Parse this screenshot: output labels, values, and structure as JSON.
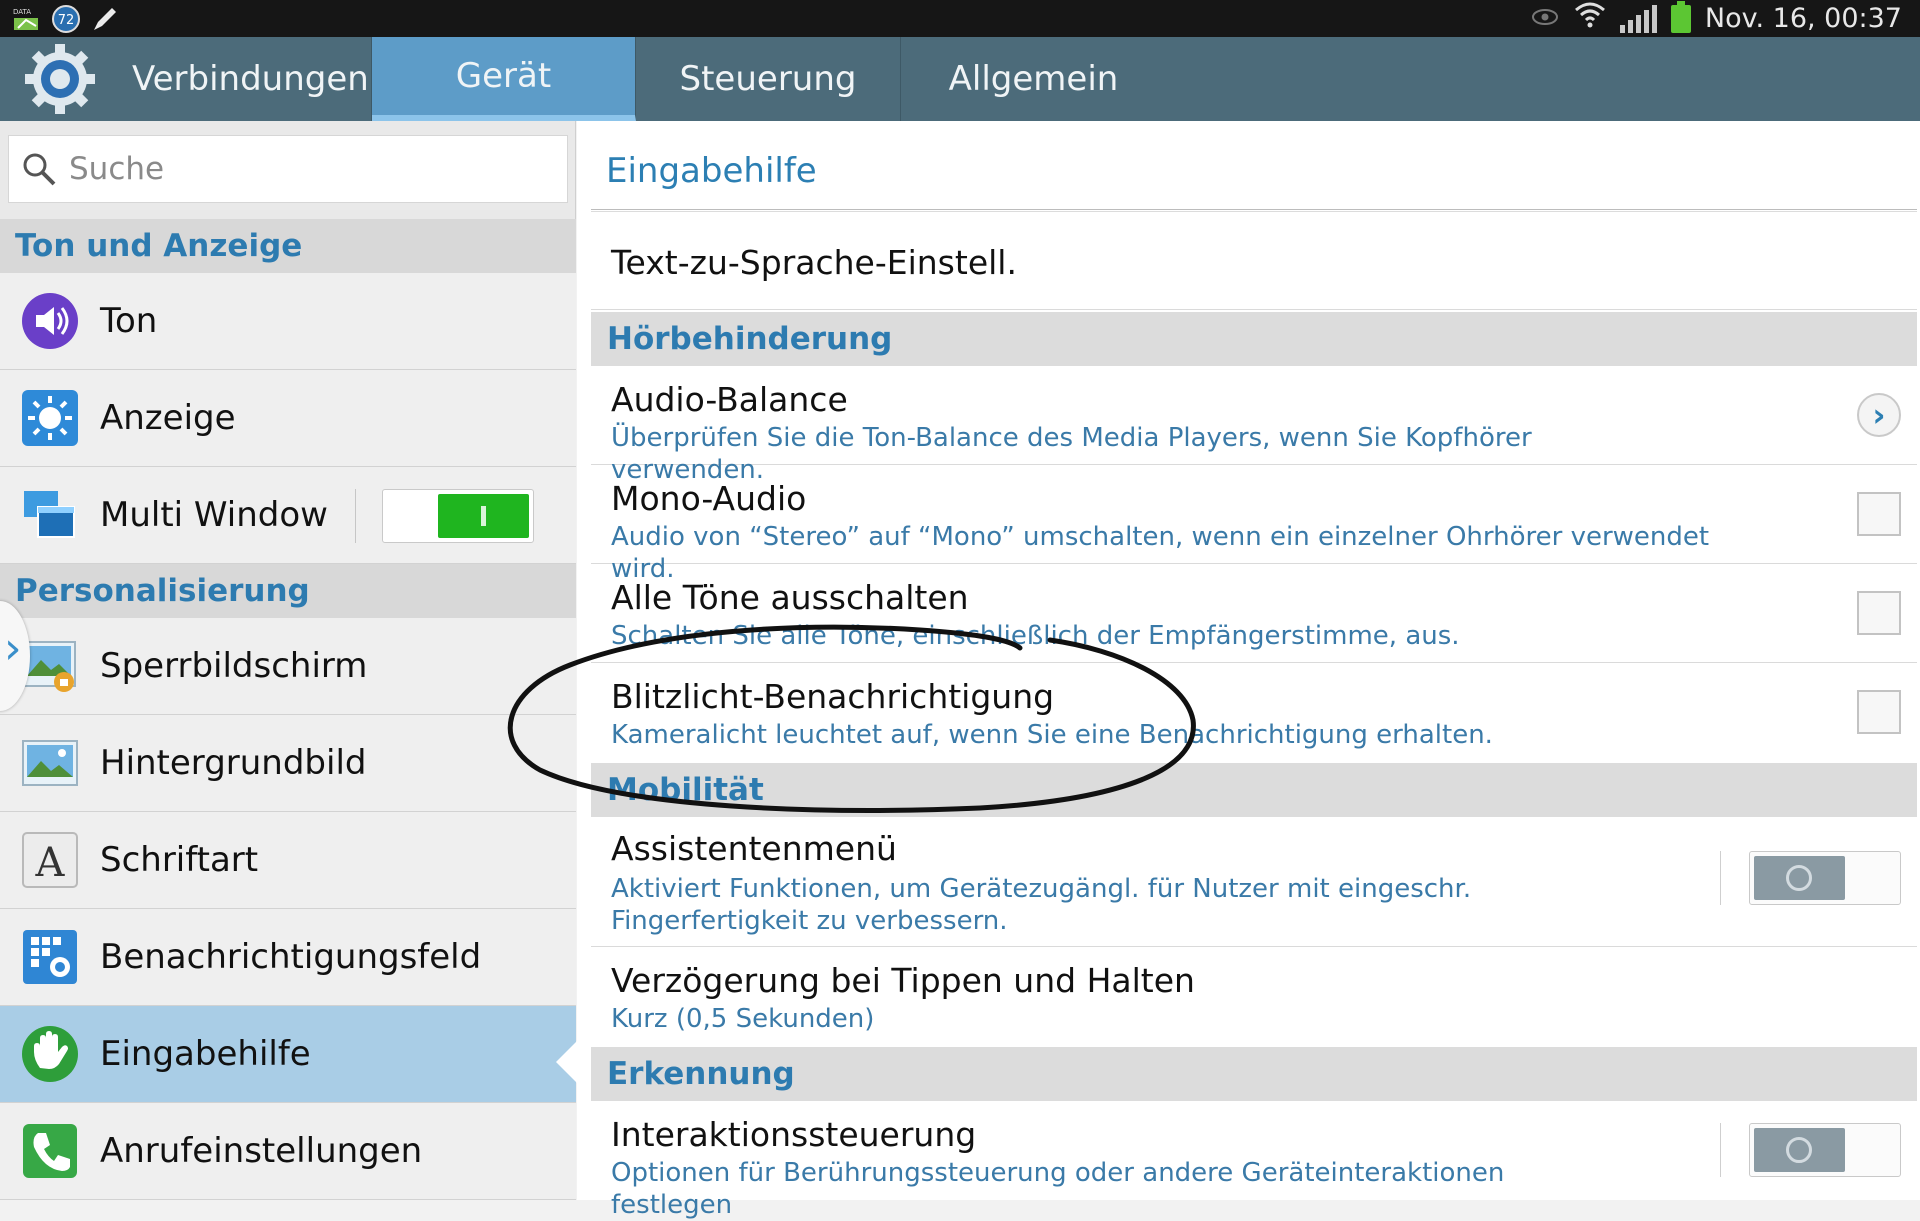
{
  "status_bar": {
    "notify_badge": "72",
    "datetime": "Nov. 16, 00:37"
  },
  "tabs": [
    {
      "label": "Verbindungen",
      "active": false
    },
    {
      "label": "Gerät",
      "active": true
    },
    {
      "label": "Steuerung",
      "active": false
    },
    {
      "label": "Allgemein",
      "active": false
    }
  ],
  "search": {
    "placeholder": "Suche"
  },
  "sidebar": {
    "sections": [
      {
        "label": "Ton und Anzeige"
      },
      {
        "label": "Personalisierung"
      }
    ],
    "items": [
      {
        "label": "Ton",
        "icon": "speaker-icon"
      },
      {
        "label": "Anzeige",
        "icon": "brightness-icon"
      },
      {
        "label": "Multi Window",
        "icon": "multi-window-icon",
        "toggle": "on"
      },
      {
        "label": "Sperrbildschirm",
        "icon": "lock-screen-icon"
      },
      {
        "label": "Hintergrundbild",
        "icon": "wallpaper-icon"
      },
      {
        "label": "Schriftart",
        "icon": "font-icon"
      },
      {
        "label": "Benachrichtigungsfeld",
        "icon": "notification-panel-icon"
      },
      {
        "label": "Eingabehilfe",
        "icon": "hand-icon",
        "selected": true
      },
      {
        "label": "Anrufeinstellungen",
        "icon": "phone-icon"
      }
    ]
  },
  "main": {
    "title": "Eingabehilfe",
    "top_item": "Text-zu-Sprache-Einstell.",
    "sections": [
      {
        "label": "Hörbehinderung",
        "rows": [
          {
            "title": "Audio-Balance",
            "subtitle": "Überprüfen Sie die Ton-Balance des Media Players, wenn Sie Kopfhörer verwenden.",
            "control": "chevron"
          },
          {
            "title": "Mono-Audio",
            "subtitle": "Audio von “Stereo” auf “Mono” umschalten, wenn ein einzelner Ohrhörer verwendet wird.",
            "control": "checkbox",
            "checked": false
          },
          {
            "title": "Alle Töne ausschalten",
            "subtitle": "Schalten Sie alle Töne, einschließlich der Empfängerstimme, aus.",
            "control": "checkbox",
            "checked": false
          },
          {
            "title": "Blitzlicht-Benachrichtigung",
            "subtitle": "Kameralicht leuchtet auf, wenn Sie eine Benachrichtigung erhalten.",
            "control": "checkbox",
            "checked": false
          }
        ]
      },
      {
        "label": "Mobilität",
        "rows": [
          {
            "title": "Assistentenmenü",
            "subtitle": "Aktiviert Funktionen, um Gerätezugängl. für Nutzer mit eingeschr. Fingerfertigkeit zu verbessern.",
            "control": "toggle",
            "on": false
          },
          {
            "title": "Verzögerung bei Tippen und Halten",
            "subtitle": "Kurz (0,5 Sekunden)",
            "control": "none"
          }
        ]
      },
      {
        "label": "Erkennung",
        "rows": [
          {
            "title": "Interaktionssteuerung",
            "subtitle": "Optionen für Berührungssteuerung oder andere Geräteinteraktionen festlegen",
            "control": "toggle",
            "on": false
          }
        ]
      }
    ]
  },
  "colors": {
    "tab_bar": "#4c6b7a",
    "tab_active": "#5d9cc8",
    "accent_text": "#2c7fb3",
    "toggle_on": "#1fb51f",
    "selected_item": "#a9cde6"
  }
}
